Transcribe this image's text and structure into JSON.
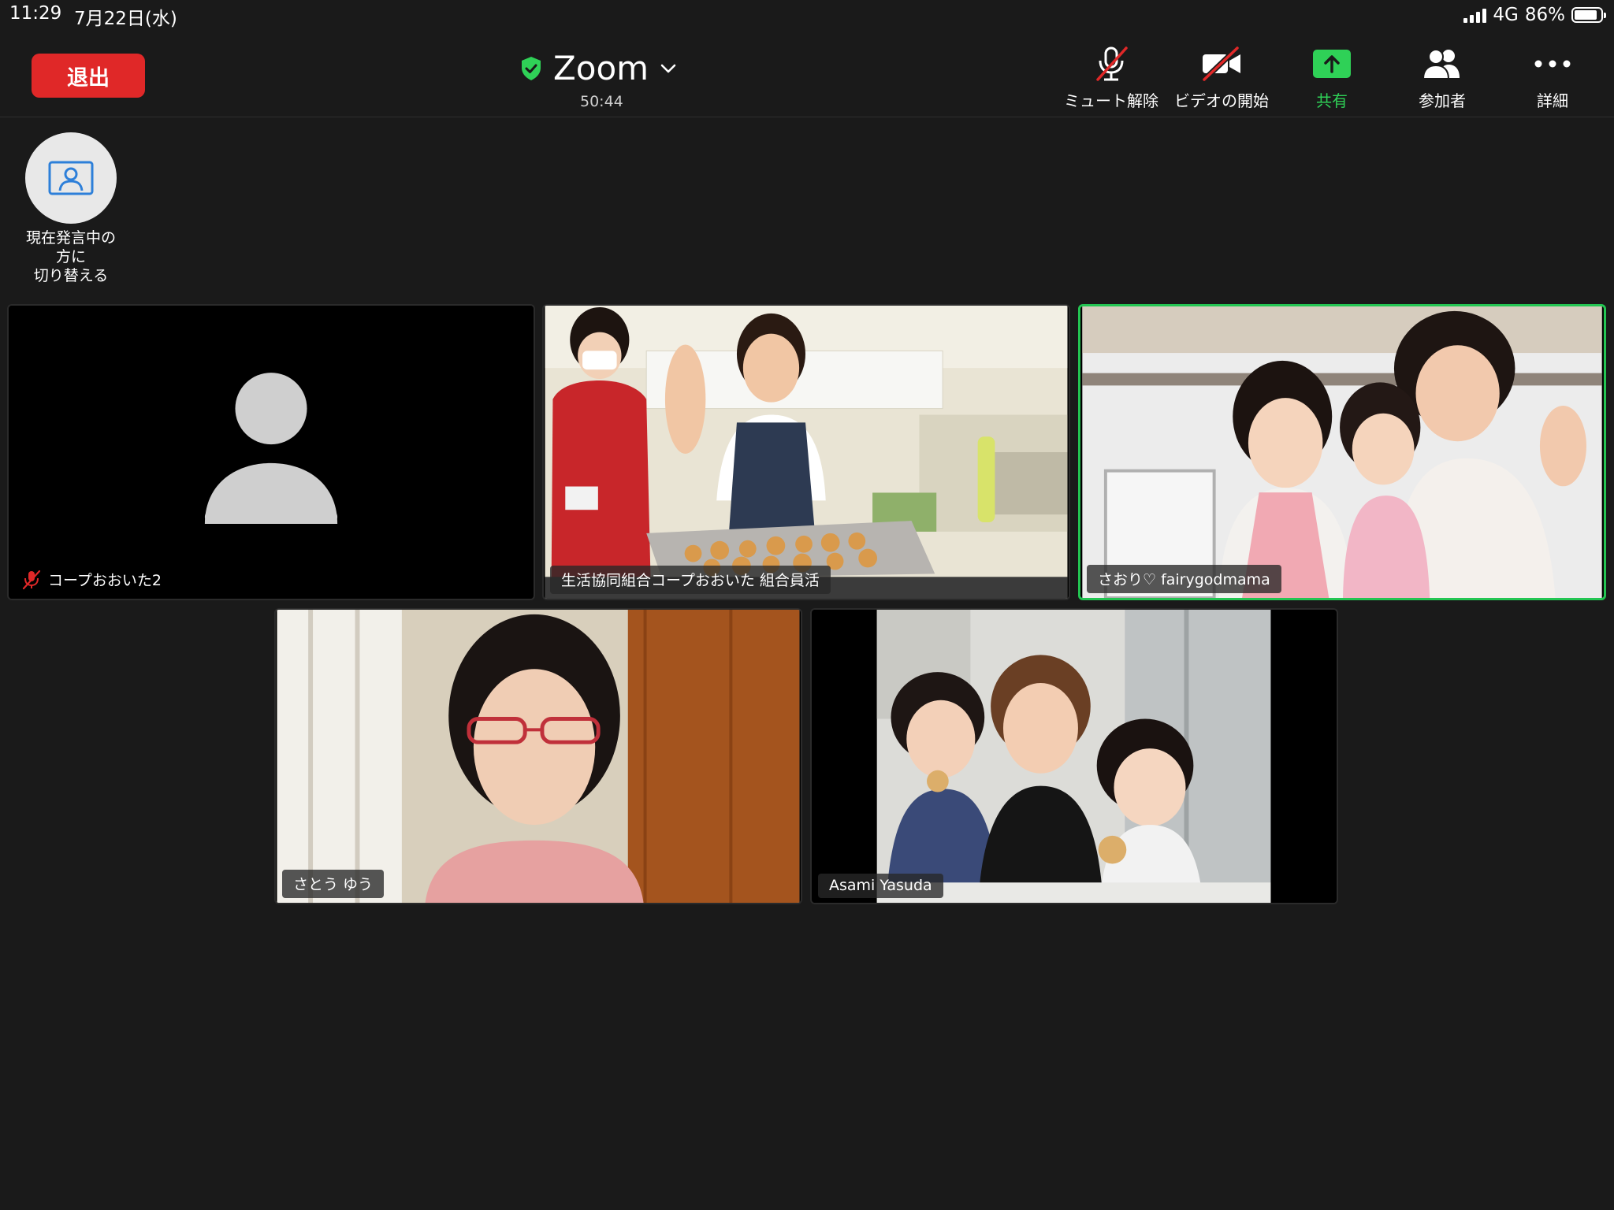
{
  "status_bar": {
    "time": "11:29",
    "date": "7月22日(水)",
    "network": "4G",
    "battery": "86%",
    "battery_level": 0.86
  },
  "toolbar": {
    "leave_label": "退出",
    "title": "Zoom",
    "timer": "50:44",
    "unmute_label": "ミュート解除",
    "start_video_label": "ビデオの開始",
    "share_label": "共有",
    "participants_label": "参加者",
    "more_label": "詳細"
  },
  "speaker_toggle": {
    "label_line1": "現在発言中の",
    "label_line2": "方に",
    "label_line3": "切り替える"
  },
  "participants": [
    {
      "name": "コープおおいた2",
      "muted": true,
      "video_on": false
    },
    {
      "name": "生活協同組合コープおおいた 組合員活",
      "muted": false,
      "video_on": true
    },
    {
      "name": "さおり♡ fairygodmama",
      "muted": false,
      "video_on": true,
      "active_speaker": true
    },
    {
      "name": "さとう ゆう",
      "muted": false,
      "video_on": true
    },
    {
      "name": "Asami Yasuda",
      "muted": false,
      "video_on": true
    }
  ],
  "colors": {
    "background": "#1a1a1a",
    "leave_button": "#e02828",
    "accent_green": "#2fd157",
    "active_border": "#23c552"
  }
}
